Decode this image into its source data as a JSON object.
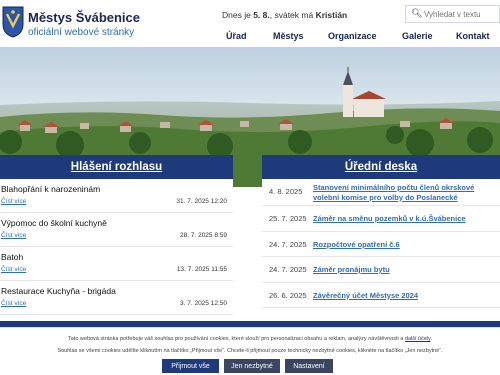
{
  "header": {
    "title": "Městys Švábenice",
    "subtitle": "oficiální webové stránky",
    "today_prefix": "Dnes je",
    "today_date": "5. 8.",
    "today_middle": ", svátek má",
    "today_name": "Kristián",
    "search_placeholder": "Vyhledat v textu"
  },
  "nav": [
    "Úřad",
    "Městys",
    "Organizace",
    "Galerie",
    "Kontakt"
  ],
  "announcements": {
    "title": "Hlášení rozhlasu",
    "items": [
      {
        "title": "Blahopřání k narozeninám",
        "more": "Číst více",
        "date": "31. 7. 2025 12:20"
      },
      {
        "title": "Výpomoc do školní kuchyně",
        "more": "Číst více",
        "date": "28. 7. 2025 8:59"
      },
      {
        "title": "Batoh",
        "more": "Číst více",
        "date": "13. 7. 2025 11:55"
      },
      {
        "title": "Restaurace Kuchyňa - brigáda",
        "more": "Číst více",
        "date": "3. 7. 2025 12:50"
      }
    ]
  },
  "notice_board": {
    "title": "Úřední deska",
    "items": [
      {
        "date": "4. 8. 2025",
        "title": "Stanovení minimálního počtu členů okrskové volební komise pro volby do Poslanecké"
      },
      {
        "date": "25. 7. 2025",
        "title": "Záměr na směnu pozemků v k.ú.Švábenice"
      },
      {
        "date": "24. 7. 2025",
        "title": "Rozpočtové opatření č.6"
      },
      {
        "date": "24. 7. 2025",
        "title": "Záměr pronájmu bytu"
      },
      {
        "date": "26. 6. 2025",
        "title": "Závěrečný účet Městyse 2024"
      }
    ]
  },
  "cookie": {
    "line1": "Tato webová stránka potřebuje váš souhlas pro používání cookies, které slouží pro personalizaci obsahu a reklam, analýzy návštěvnosti a",
    "link": "další účely",
    "line2": "Souhlas se všemi cookies udělíte kliknutím na tlačítko „Přijmout vše“. Chcete-li přijmout pouze technicky nezbytné cookies, klikněte na tlačítko „Jen nezbytné“.",
    "accept": "Přijmout vše",
    "necessary": "Jen nezbytné",
    "settings": "Nastavení"
  },
  "colors": {
    "brand": "#1f3a7a",
    "link": "#2f6db5"
  }
}
